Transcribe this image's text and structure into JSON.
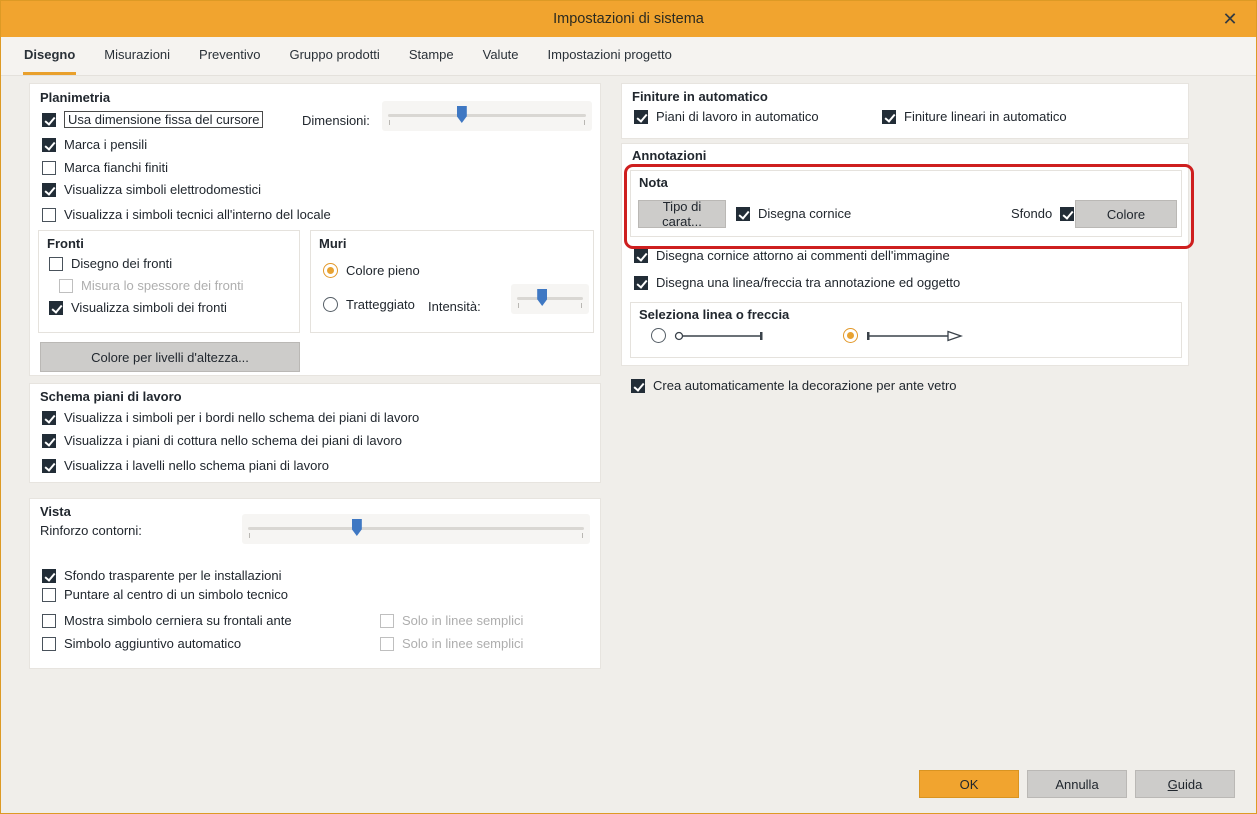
{
  "window": {
    "title": "Impostazioni di sistema",
    "close_icon": "✕"
  },
  "tabs": [
    {
      "label": "Disegno",
      "active": true
    },
    {
      "label": "Misurazioni",
      "active": false
    },
    {
      "label": "Preventivo",
      "active": false
    },
    {
      "label": "Gruppo prodotti",
      "active": false
    },
    {
      "label": "Stampe",
      "active": false
    },
    {
      "label": "Valute",
      "active": false
    },
    {
      "label": "Impostazioni progetto",
      "active": false
    }
  ],
  "planimetria": {
    "title": "Planimetria",
    "usa_dimensione": "Usa dimensione fissa del cursore",
    "dimensioni_label": "Dimensioni:",
    "marca_pensili": "Marca i pensili",
    "marca_fianchi": "Marca fianchi finiti",
    "simboli_elettro": "Visualizza simboli elettrodomestici",
    "simboli_tecnici": "Visualizza i simboli tecnici all'interno del locale"
  },
  "fronti": {
    "title": "Fronti",
    "disegno_fronti": "Disegno dei fronti",
    "misura_spessore": "Misura lo spessore dei fronti",
    "simboli_fronti": "Visualizza simboli dei fronti"
  },
  "muri": {
    "title": "Muri",
    "colore_pieno": "Colore pieno",
    "tratteggiato": "Tratteggiato",
    "intensita_label": "Intensità:"
  },
  "buttons": {
    "colore_livelli": "Colore per livelli d'altezza..."
  },
  "schema": {
    "title": "Schema piani di lavoro",
    "items": [
      "Visualizza i simboli per i bordi nello schema dei piani di lavoro",
      "Visualizza i piani di cottura nello schema dei piani di lavoro",
      "Visualizza i lavelli nello schema piani di lavoro"
    ]
  },
  "vista": {
    "title": "Vista",
    "rinforzo_label": "Rinforzo contorni:",
    "sfondo_trasparente": "Sfondo trasparente per le installazioni",
    "puntare_centro": "Puntare al centro di un simbolo tecnico",
    "mostra_cerniera": "Mostra simbolo cerniera su frontali ante",
    "simbolo_aggiuntivo": "Simbolo aggiuntivo automatico",
    "solo_linee_1": "Solo in linee semplici",
    "solo_linee_2": "Solo in linee semplici"
  },
  "finiture": {
    "title": "Finiture in automatico",
    "piani_lavoro": "Piani di lavoro in automatico",
    "finiture_lineari": "Finiture lineari in automatico"
  },
  "annotazioni": {
    "title": "Annotazioni",
    "nota": {
      "title": "Nota",
      "tipo_carattere_button": "Tipo di carat...",
      "disegna_cornice": "Disegna cornice",
      "sfondo_label": "Sfondo",
      "colore_button": "Colore"
    },
    "cornice_commenti": "Disegna cornice attorno ai commenti dell'immagine",
    "linea_freccia": "Disegna una linea/freccia tra annotazione ed oggetto",
    "seleziona_title": "Seleziona linea o freccia"
  },
  "crea_decorazione": "Crea automaticamente la decorazione per ante vetro",
  "footer": {
    "ok": "OK",
    "annulla": "Annulla",
    "guida_key": "G",
    "guida_rest": "uida"
  },
  "sliders": {
    "dimensioni_pct": 38,
    "intensita_pct": 40,
    "rinforzo_pct": 33
  },
  "states": {
    "usa_dimensione": true,
    "marca_pensili": true,
    "marca_fianchi": false,
    "simboli_elettro": true,
    "simboli_tecnici": false,
    "disegno_fronti": false,
    "misura_spessore": false,
    "simboli_fronti": true,
    "colore_pieno": true,
    "tratteggiato": false,
    "schema_0": true,
    "schema_1": true,
    "schema_2": true,
    "sfondo_trasparente": true,
    "puntare_centro": false,
    "mostra_cerniera": false,
    "solo_linee_1": false,
    "simbolo_aggiuntivo": false,
    "solo_linee_2": false,
    "piani_lavoro": true,
    "finiture_lineari": true,
    "disegna_cornice": true,
    "sfondo_nota": true,
    "cornice_commenti": true,
    "linea_freccia": true,
    "linea_option": false,
    "freccia_option": true,
    "crea_decorazione": true
  },
  "colors": {
    "accent": "#F1A42F",
    "highlight_red": "#CE1F1F",
    "checkbox_dark": "#222D37",
    "slider_handle": "#3F78C3"
  }
}
